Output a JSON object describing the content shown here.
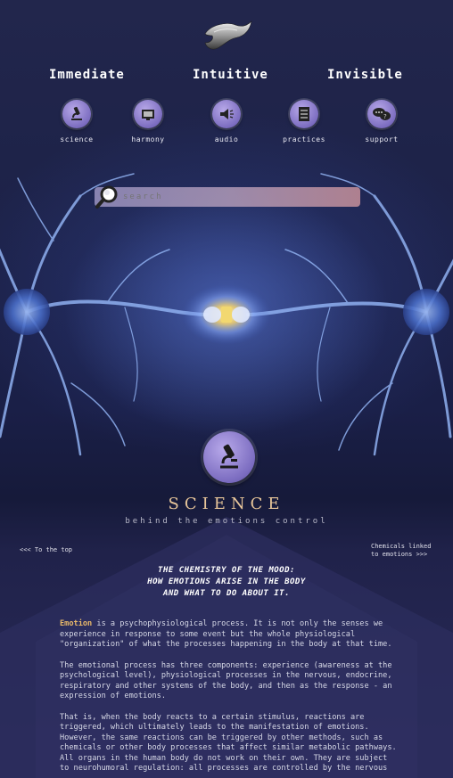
{
  "taglines": [
    "Immediate",
    "Intuitive",
    "Invisible"
  ],
  "nav": [
    {
      "label": "science",
      "icon": "microscope-icon"
    },
    {
      "label": "harmony",
      "icon": "monitor-icon"
    },
    {
      "label": "audio",
      "icon": "speaker-icon"
    },
    {
      "label": "practices",
      "icon": "checklist-icon"
    },
    {
      "label": "support",
      "icon": "chat-bubble-icon"
    }
  ],
  "search": {
    "placeholder": "search"
  },
  "section": {
    "title": "SCIENCE",
    "subtitle": "behind the emotions control",
    "prev_link": "<<< To the top",
    "next_link_line1": "Chemicals linked",
    "next_link_line2": "to emotions >>>"
  },
  "headline": [
    "THE CHEMISTRY OF THE MOOD:",
    "HOW EMOTIONS ARISE IN THE BODY",
    "AND WHAT TO DO ABOUT IT."
  ],
  "article": {
    "p1_highlight": "Emotion",
    "p1_rest": " is a psychophysiological process. It is not only the senses we experience in response to some event but the whole physiological \"organization\" of what the processes happening in the body at that time.",
    "p2": "The emotional process has three components: experience (awareness at the psychological level), physiological processes in the nervous, endocrine, respiratory and other systems of the body, and then as the response - an expression of emotions.",
    "p3": "That is, when the body reacts to a certain stimulus, reactions are triggered, which ultimately leads to the manifestation of emotions. However, the same reactions can be triggered by other methods, such as chemicals or other body processes that affect similar metabolic pathways. All organs in the human body do not work on their own. They are subject to neurohumoral regulation: all processes are controlled by the nervous"
  }
}
